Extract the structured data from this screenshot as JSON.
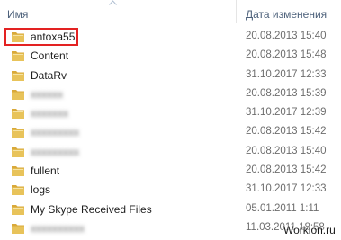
{
  "header": {
    "name_label": "Имя",
    "date_label": "Дата изменения"
  },
  "colors": {
    "folder": "#e8c35a",
    "highlight": "#e32222",
    "header_text": "#4c607a"
  },
  "rows": [
    {
      "name": "antoxa55",
      "date": "20.08.2013 15:40",
      "highlighted": true,
      "blurred": false,
      "icon": "folder-icon"
    },
    {
      "name": "Content",
      "date": "20.08.2013 15:48",
      "highlighted": false,
      "blurred": false,
      "icon": "folder-icon"
    },
    {
      "name": "DataRv",
      "date": "31.10.2017 12:33",
      "highlighted": false,
      "blurred": false,
      "icon": "folder-icon"
    },
    {
      "name": "xxxxxx",
      "date": "20.08.2013 15:39",
      "highlighted": false,
      "blurred": true,
      "icon": "folder-icon"
    },
    {
      "name": "xxxxxxx",
      "date": "31.10.2017 12:39",
      "highlighted": false,
      "blurred": true,
      "icon": "folder-icon"
    },
    {
      "name": "xxxxxxxxx",
      "date": "20.08.2013 15:42",
      "highlighted": false,
      "blurred": true,
      "icon": "folder-icon"
    },
    {
      "name": "xxxxxxxxx",
      "date": "20.08.2013 15:40",
      "highlighted": false,
      "blurred": true,
      "icon": "folder-icon"
    },
    {
      "name": "fullent",
      "date": "20.08.2013 15:42",
      "highlighted": false,
      "blurred": false,
      "icon": "folder-icon"
    },
    {
      "name": "logs",
      "date": "31.10.2017 12:33",
      "highlighted": false,
      "blurred": false,
      "icon": "folder-icon"
    },
    {
      "name": "My Skype Received Files",
      "date": "05.01.2011 1:11",
      "highlighted": false,
      "blurred": false,
      "icon": "folder-icon"
    },
    {
      "name": "xxxxxxxxxx",
      "date": "11.03.2011 18:58",
      "highlighted": false,
      "blurred": true,
      "icon": "folder-icon"
    }
  ],
  "watermark": "Workion.ru"
}
